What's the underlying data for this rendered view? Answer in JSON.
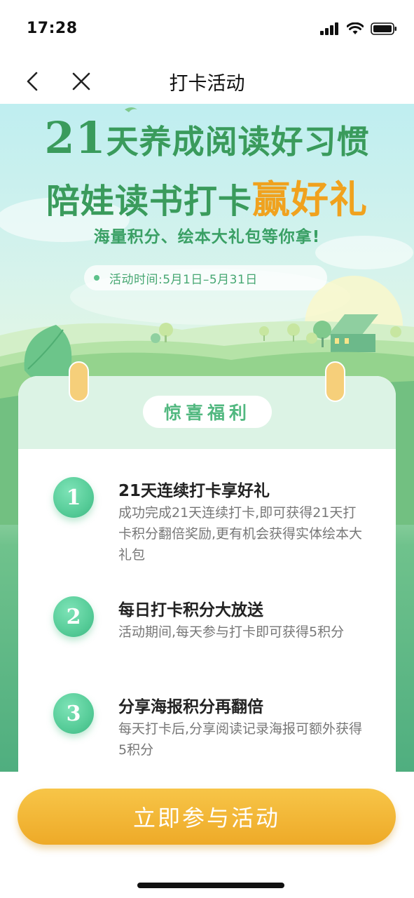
{
  "status_bar": {
    "time": "17:28"
  },
  "nav": {
    "title": "打卡活动"
  },
  "hero": {
    "headline_number": "21",
    "headline_rest": "天养成阅读好习惯",
    "headline2_main": "陪娃读书打卡",
    "headline2_accent": "赢好礼",
    "subline": "海量积分、绘本大礼包等你拿!",
    "activity_time": "活动时间:5月1日–5月31日"
  },
  "card": {
    "badge": "惊喜福利",
    "benefits": [
      {
        "number": "1",
        "title": "21天连续打卡享好礼",
        "desc": "成功完成21天连续打卡,即可获得21天打卡积分翻倍奖励,更有机会获得实体绘本大礼包"
      },
      {
        "number": "2",
        "title": "每日打卡积分大放送",
        "desc": "活动期间,每天参与打卡即可获得5积分"
      },
      {
        "number": "3",
        "title": "分享海报积分再翻倍",
        "desc": "每天打卡后,分享阅读记录海报可额外获得5积分"
      }
    ]
  },
  "cta": {
    "label": "立即参与活动"
  },
  "colors": {
    "brand_green": "#3a9b5c",
    "accent_orange": "#f0a21e",
    "cta_gold": "#f0b030"
  }
}
